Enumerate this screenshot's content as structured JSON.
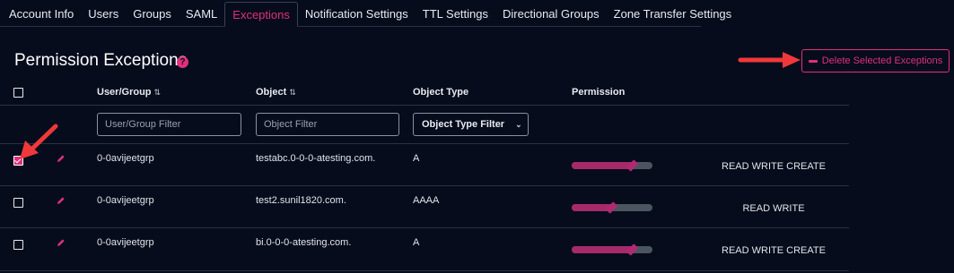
{
  "tabs": [
    {
      "label": "Account Info",
      "active": false
    },
    {
      "label": "Users",
      "active": false
    },
    {
      "label": "Groups",
      "active": false
    },
    {
      "label": "SAML",
      "active": false
    },
    {
      "label": "Exceptions",
      "active": true
    },
    {
      "label": "Notification Settings",
      "active": false
    },
    {
      "label": "TTL Settings",
      "active": false
    },
    {
      "label": "Directional Groups",
      "active": false
    },
    {
      "label": "Zone Transfer Settings",
      "active": false
    }
  ],
  "page": {
    "title": "Permission Exceptions",
    "help_icon": "help-icon",
    "help_glyph": "?",
    "delete_label": "Delete Selected Exceptions"
  },
  "table": {
    "headers": {
      "user_group": "User/Group",
      "object": "Object",
      "object_type": "Object Type",
      "permission": "Permission",
      "sort_glyph": "⇅"
    },
    "filters": {
      "user_group_placeholder": "User/Group Filter",
      "object_placeholder": "Object Filter",
      "object_type_label": "Object Type Filter",
      "chevron": "⌄"
    },
    "rows": [
      {
        "checked": true,
        "user_group": "0-0avijeetgrp",
        "object": "testabc.0-0-0-atesting.com.",
        "object_type": "A",
        "permission_level": 0.75,
        "permission": "READ WRITE CREATE"
      },
      {
        "checked": false,
        "user_group": "0-0avijeetgrp",
        "object": "test2.sunil1820.com.",
        "object_type": "AAAA",
        "permission_level": 0.5,
        "permission": "READ WRITE"
      },
      {
        "checked": false,
        "user_group": "0-0avijeetgrp",
        "object": "bi.0-0-0-atesting.com.",
        "object_type": "A",
        "permission_level": 0.75,
        "permission": "READ WRITE CREATE"
      }
    ]
  },
  "colors": {
    "background": "#060c1c",
    "accent": "#e0307a",
    "slider_fill": "#a62a6a",
    "slider_track": "#4a5560",
    "annotation_arrow": "#f0383a"
  }
}
